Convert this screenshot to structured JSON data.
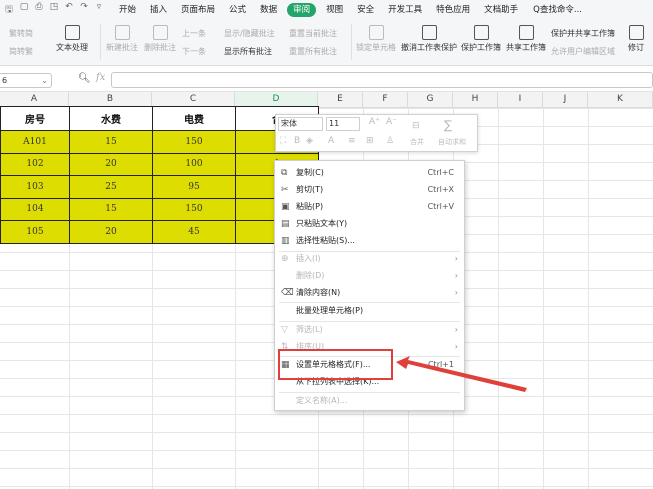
{
  "menu": {
    "quick_icons": [
      "save-icon",
      "undo-icon",
      "print-icon",
      "preview-icon",
      "undo-arrow-icon",
      "redo-arrow-icon",
      "dropdown-icon"
    ],
    "tabs": [
      "开始",
      "插入",
      "页面布局",
      "公式",
      "数据",
      "审阅",
      "视图",
      "安全",
      "开发工具",
      "特色应用",
      "文档助手"
    ],
    "active": "审阅",
    "search": "Q查找命令..."
  },
  "ribbon": {
    "spell": "繁转简",
    "trad": "简转繁",
    "textproc": "文本处理",
    "newcomment": "新建批注",
    "delcomment": "删除批注",
    "prev": "上一条",
    "next": "下一条",
    "showhide": "显示/隐藏批注",
    "showall": "显示所有批注",
    "resetcur": "重置当前批注",
    "resetall": "重置所有批注",
    "lockcell": "锁定单元格",
    "unprotect": "撤消工作表保护",
    "protectsheet": "保护工作簿",
    "sharewb": "共享工作簿",
    "protectshare": "保护并共享工作簿",
    "allowedit": "允许用户编辑区域",
    "revise": "修订"
  },
  "formula": {
    "namebox": "6",
    "fx": "fx",
    "value": ""
  },
  "columns": [
    "A",
    "B",
    "C",
    "D",
    "E",
    "F",
    "G",
    "H",
    "I",
    "J",
    "K"
  ],
  "table": {
    "headers": [
      "房号",
      "水费",
      "电费",
      "合"
    ],
    "rows": [
      [
        "A101",
        "15",
        "150",
        "1"
      ],
      [
        "102",
        "20",
        "100",
        "1"
      ],
      [
        "103",
        "25",
        "95",
        "1"
      ],
      [
        "104",
        "15",
        "150",
        "1"
      ],
      [
        "105",
        "20",
        "45",
        "6"
      ]
    ]
  },
  "mini_toolbar": {
    "font": "宋体",
    "size": "11",
    "merge": "合并",
    "autosum": "自动求和"
  },
  "context_menu": {
    "copy": {
      "label": "复制(C)",
      "shortcut": "Ctrl+C"
    },
    "cut": {
      "label": "剪切(T)",
      "shortcut": "Ctrl+X"
    },
    "paste": {
      "label": "粘贴(P)",
      "shortcut": "Ctrl+V"
    },
    "paste_text": {
      "label": "只粘贴文本(Y)"
    },
    "paste_special": {
      "label": "选择性粘贴(S)..."
    },
    "insert": {
      "label": "插入(I)"
    },
    "delete": {
      "label": "删除(D)"
    },
    "clear": {
      "label": "清除内容(N)"
    },
    "batch": {
      "label": "批量处理单元格(P)"
    },
    "filter": {
      "label": "筛选(L)"
    },
    "sort": {
      "label": "排序(U)"
    },
    "format_cells": {
      "label": "设置单元格格式(F)...",
      "shortcut": "Ctrl+1"
    },
    "pick_list": {
      "label": "从下拉列表中选择(K)..."
    },
    "define_name": {
      "label": "定义名称(A)..."
    }
  },
  "colors": {
    "accent": "#23a56b",
    "table_fill": "#dedd01",
    "highlight_cell": "#ffff00",
    "callout_red": "#e0403a"
  }
}
